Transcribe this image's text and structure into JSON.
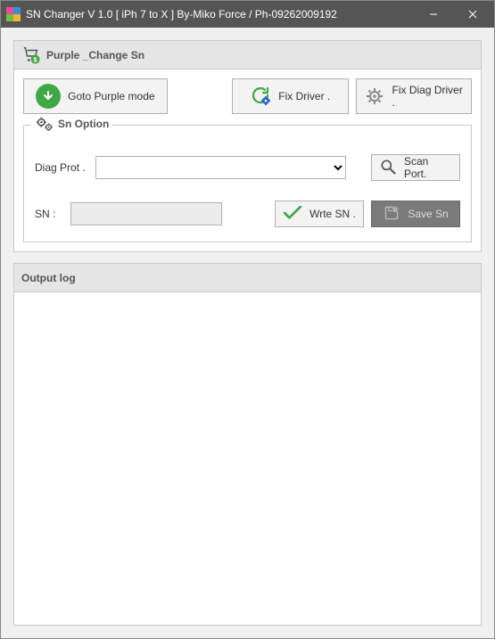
{
  "window": {
    "title": "SN Changer V 1.0  [ iPh 7 to X ] By-Miko Force  / Ph-09262009192"
  },
  "mainPanel": {
    "headerLabel": "Purple _Change Sn",
    "buttons": {
      "gotoPurple": "Goto Purple mode",
      "fixDriver": "Fix Driver .",
      "fixDiagDriver": "Fix Diag Driver ."
    },
    "snOption": {
      "legend": "Sn Option",
      "diagPortLabel": "Diag Prot .",
      "diagPortValue": "",
      "scanPort": "Scan Port.",
      "snLabel": "SN :",
      "snValue": "",
      "writeSn": "Wrte SN .",
      "saveSn": "Save Sn"
    }
  },
  "outputPanel": {
    "header": "Output log",
    "content": ""
  }
}
